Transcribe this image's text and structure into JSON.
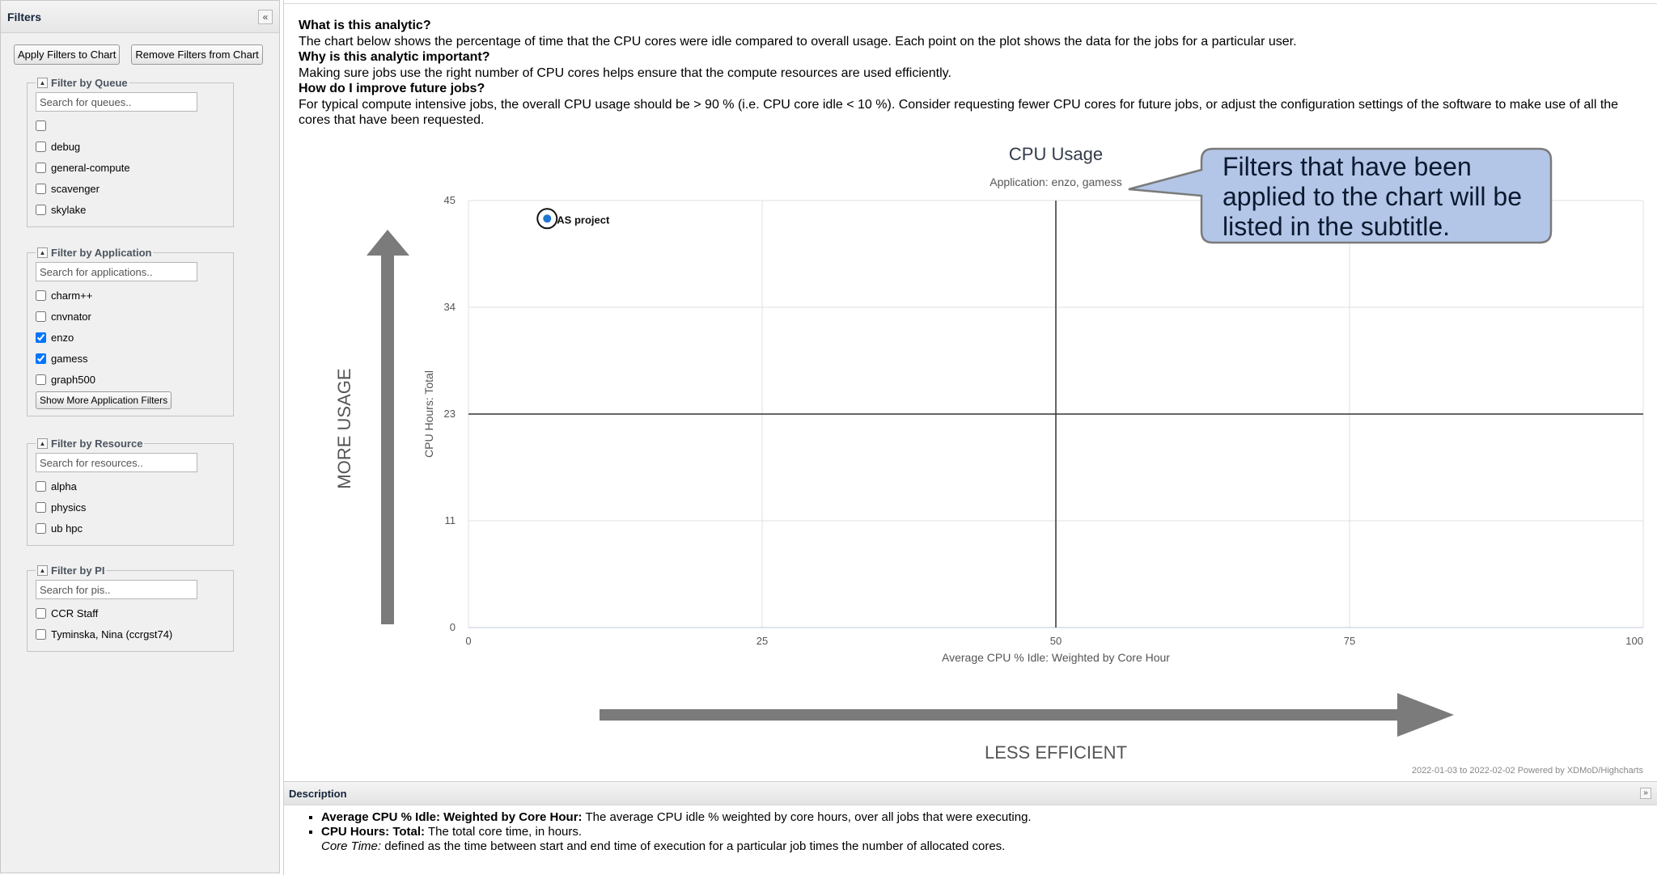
{
  "filters": {
    "title": "Filters",
    "apply_label": "Apply Filters to Chart",
    "remove_label": "Remove Filters from Chart",
    "groups": [
      {
        "title": "Filter by Queue",
        "placeholder": "Search for queues..",
        "options": [
          {
            "label": "",
            "checked": false
          },
          {
            "label": "debug",
            "checked": false
          },
          {
            "label": "general-compute",
            "checked": false
          },
          {
            "label": "scavenger",
            "checked": false
          },
          {
            "label": "skylake",
            "checked": false
          }
        ]
      },
      {
        "title": "Filter by Application",
        "placeholder": "Search for applications..",
        "options": [
          {
            "label": "charm++",
            "checked": false
          },
          {
            "label": "cnvnator",
            "checked": false
          },
          {
            "label": "enzo",
            "checked": true
          },
          {
            "label": "gamess",
            "checked": true
          },
          {
            "label": "graph500",
            "checked": false
          }
        ],
        "more_label": "Show More Application Filters"
      },
      {
        "title": "Filter by Resource",
        "placeholder": "Search for resources..",
        "options": [
          {
            "label": "alpha",
            "checked": false
          },
          {
            "label": "physics",
            "checked": false
          },
          {
            "label": "ub hpc",
            "checked": false
          }
        ]
      },
      {
        "title": "Filter by PI",
        "placeholder": "Search for pis..",
        "options": [
          {
            "label": "CCR Staff",
            "checked": false
          },
          {
            "label": "Tyminska, Nina (ccrgst74)",
            "checked": false
          }
        ]
      }
    ]
  },
  "info": {
    "q1": "What is this analytic?",
    "a1": "The chart below shows the percentage of time that the CPU cores were idle compared to overall usage. Each point on the plot shows the data for the jobs for a particular user.",
    "q2": "Why is this analytic important?",
    "a2": "Making sure jobs use the right number of CPU cores helps ensure that the compute resources are used efficiently.",
    "q3": "How do I improve future jobs?",
    "a3": "For typical compute intensive jobs, the overall CPU usage should be > 90 % (i.e. CPU core idle < 10 %). Consider requesting fewer CPU cores for future jobs, or adjust the configuration settings of the software to make use of all the cores that have been requested."
  },
  "callout": {
    "text": "Filters that have been applied to the chart will be listed in the subtitle."
  },
  "chart_data": {
    "type": "scatter",
    "title": "CPU Usage",
    "subtitle": "Application: enzo, gamess",
    "xlabel": "Average CPU % Idle: Weighted by Core Hour",
    "ylabel": "CPU Hours: Total",
    "xlim": [
      0,
      100
    ],
    "ylim": [
      0,
      45
    ],
    "x_ticks": [
      0,
      25,
      50,
      75,
      100
    ],
    "y_ticks": [
      "0",
      "11",
      "23",
      "34",
      "45"
    ],
    "y_tick_values": [
      0,
      11.25,
      22.5,
      33.75,
      45
    ],
    "quadrant_lines": {
      "x": 50,
      "y": 22.5
    },
    "points": [
      {
        "x": 6.7,
        "y": 43.1,
        "label": "AS project"
      }
    ],
    "axis_annotations": {
      "vertical": "MORE USAGE",
      "horizontal": "LESS EFFICIENT"
    },
    "credits": "2022-01-03 to 2022-02-02 Powered by XDMoD/Highcharts",
    "colors": {
      "point": "#1f77d0",
      "quadrant_line": "#333333",
      "grid": "#e0e0e0",
      "arrow": "#7b7b7b"
    }
  },
  "description": {
    "title": "Description",
    "items": [
      {
        "term": "Average CPU % Idle: Weighted by Core Hour:",
        "text": " The average CPU idle % weighted by core hours, over all jobs that were executing."
      },
      {
        "term": "CPU Hours: Total:",
        "text": " The total core time, in hours.",
        "sub_term": "Core Time:",
        "sub_text": " defined as the time between start and end time of execution for a particular job times the number of allocated cores."
      }
    ]
  }
}
